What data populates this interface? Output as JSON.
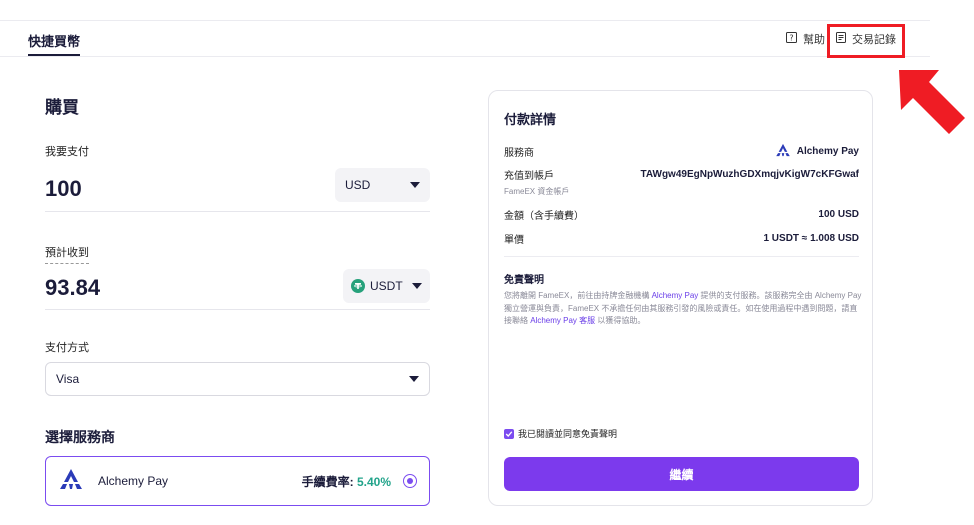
{
  "header": {
    "tab_active": "快捷買幣",
    "help_label": "幫助",
    "records_label": "交易記錄"
  },
  "buy": {
    "title": "購買",
    "pay_label": "我要支付",
    "pay_amount": "100",
    "pay_currency": "USD",
    "receive_label": "預計收到",
    "receive_amount": "93.84",
    "receive_currency": "USDT",
    "method_label": "支付方式",
    "method_value": "Visa",
    "provider_section_title": "選擇服務商",
    "provider": {
      "name": "Alchemy Pay",
      "fee_label": "手續費率:",
      "fee_value": "5.40%"
    }
  },
  "details": {
    "title": "付款詳情",
    "provider_label": "服務商",
    "provider_value": "Alchemy Pay",
    "account_label": "充值到帳戶",
    "account_value": "TAWgw49EgNpWuzhGDXmqjvKigW7cKFGwaf",
    "account_sub": "FameEX 資金帳戶",
    "amount_label": "金額（含手續費）",
    "amount_value": "100 USD",
    "price_label": "單價",
    "price_value": "1 USDT ≈ 1.008 USD",
    "disclaimer_title": "免責聲明",
    "disclaimer_p1": "您將離開 FameEX，前往由持牌金融機構 ",
    "disclaimer_hl1": "Alchemy Pay",
    "disclaimer_p2": " 提供的支付服務。該服務完全由 Alchemy Pay 獨立營運與負責，FameEX 不承擔任何由其服務引發的風險或責任。如在使用過程中遇到問題，請直接聯絡 ",
    "disclaimer_hl2": "Alchemy Pay 客服",
    "disclaimer_p3": " 以獲得協助。",
    "agree_label": "我已閱讀並同意免責聲明",
    "continue_label": "繼續"
  },
  "colors": {
    "accent": "#7c3aed",
    "fee_green": "#21a38a",
    "annotation_red": "#ef1c24"
  },
  "icons": [
    "help-icon",
    "records-icon",
    "chevron-down-icon",
    "tether-icon",
    "alchemy-pay-logo",
    "checkbox-checked-icon",
    "annotation-arrow-icon"
  ]
}
